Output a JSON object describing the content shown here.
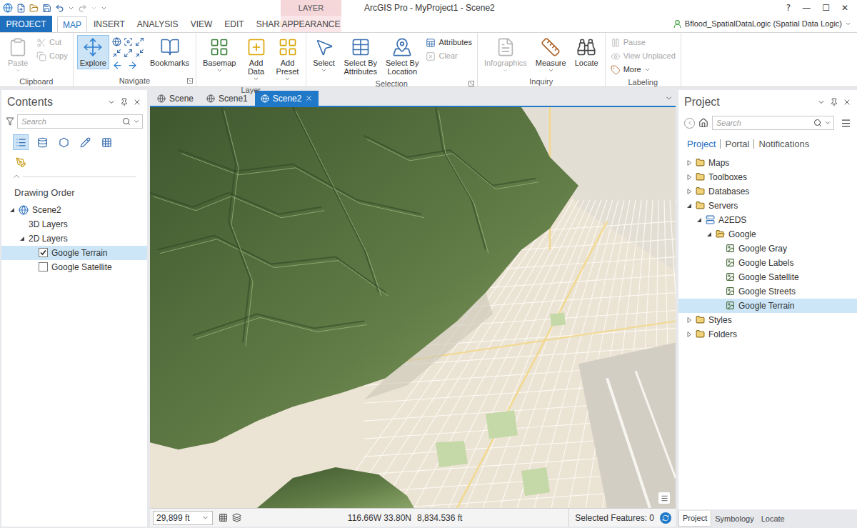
{
  "window": {
    "title": "ArcGIS Pro - MyProject1 - Scene2",
    "controls": [
      "?",
      "—",
      "☐",
      "✕"
    ]
  },
  "contextual_group": {
    "label": "LAYER"
  },
  "ribbon_tabs": [
    {
      "label": "PROJECT",
      "kind": "backstage",
      "selected": false
    },
    {
      "label": "MAP",
      "kind": "tab",
      "selected": true
    },
    {
      "label": "INSERT",
      "kind": "tab",
      "selected": false
    },
    {
      "label": "ANALYSIS",
      "kind": "tab",
      "selected": false
    },
    {
      "label": "VIEW",
      "kind": "tab",
      "selected": false
    },
    {
      "label": "EDIT",
      "kind": "tab",
      "selected": false
    },
    {
      "label": "SHARE",
      "kind": "tab",
      "selected": false
    },
    {
      "label": "APPEARANCE",
      "kind": "contextual",
      "selected": false
    }
  ],
  "user": {
    "label": "Bflood_SpatialDataLogic (Spatial Data Logic)"
  },
  "ribbon_groups": [
    {
      "label": "Clipboard",
      "launcher": false,
      "buttons": [
        {
          "kind": "large",
          "lines": [
            "Paste"
          ],
          "dropdown": true,
          "disabled": true,
          "selected": false
        },
        {
          "kind": "small",
          "lines": [
            "Cut"
          ],
          "dropdown": false,
          "disabled": true,
          "selected": false
        },
        {
          "kind": "small",
          "lines": [
            "Copy"
          ],
          "dropdown": false,
          "disabled": true,
          "selected": false
        }
      ]
    },
    {
      "label": "Navigate",
      "launcher": true,
      "buttons": [
        {
          "kind": "large",
          "lines": [
            "Explore"
          ],
          "dropdown": false,
          "disabled": false,
          "selected": true
        },
        {
          "kind": "nav-icons",
          "lines": [],
          "dropdown": false,
          "disabled": false,
          "selected": false
        },
        {
          "kind": "large",
          "lines": [
            "Bookmarks"
          ],
          "dropdown": false,
          "disabled": false,
          "selected": false
        }
      ]
    },
    {
      "label": "Layer",
      "launcher": false,
      "buttons": [
        {
          "kind": "large",
          "lines": [
            "Basemap"
          ],
          "dropdown": true,
          "disabled": false,
          "selected": false
        },
        {
          "kind": "large",
          "lines": [
            "Add",
            "Data"
          ],
          "dropdown": true,
          "disabled": false,
          "selected": false
        },
        {
          "kind": "large",
          "lines": [
            "Add",
            "Preset"
          ],
          "dropdown": true,
          "disabled": false,
          "selected": false
        }
      ]
    },
    {
      "label": "Selection",
      "launcher": true,
      "buttons": [
        {
          "kind": "large",
          "lines": [
            "Select"
          ],
          "dropdown": true,
          "disabled": false,
          "selected": false
        },
        {
          "kind": "large",
          "lines": [
            "Select By",
            "Attributes"
          ],
          "dropdown": false,
          "disabled": false,
          "selected": false
        },
        {
          "kind": "large",
          "lines": [
            "Select By",
            "Location"
          ],
          "dropdown": false,
          "disabled": false,
          "selected": false
        },
        {
          "kind": "small",
          "lines": [
            "Attributes"
          ],
          "dropdown": false,
          "disabled": false,
          "selected": false
        },
        {
          "kind": "small",
          "lines": [
            "Clear"
          ],
          "dropdown": false,
          "disabled": true,
          "selected": false
        }
      ]
    },
    {
      "label": "Inquiry",
      "launcher": false,
      "buttons": [
        {
          "kind": "large",
          "lines": [
            "Infographics"
          ],
          "dropdown": true,
          "disabled": true,
          "selected": false
        },
        {
          "kind": "large",
          "lines": [
            "Measure"
          ],
          "dropdown": true,
          "disabled": false,
          "selected": false
        },
        {
          "kind": "large",
          "lines": [
            "Locate"
          ],
          "dropdown": false,
          "disabled": false,
          "selected": false
        }
      ]
    },
    {
      "label": "Labeling",
      "launcher": false,
      "buttons": [
        {
          "kind": "small",
          "lines": [
            "Pause"
          ],
          "dropdown": false,
          "disabled": true,
          "selected": false
        },
        {
          "kind": "small",
          "lines": [
            "View Unplaced"
          ],
          "dropdown": false,
          "disabled": true,
          "selected": false
        },
        {
          "kind": "small",
          "lines": [
            "More"
          ],
          "dropdown": true,
          "disabled": false,
          "selected": false
        }
      ]
    }
  ],
  "contents": {
    "title": "Contents",
    "search": {
      "placeholder": "Search"
    },
    "views": [
      {
        "selected": true
      },
      {
        "selected": false
      },
      {
        "selected": false
      },
      {
        "selected": false
      },
      {
        "selected": false
      },
      {
        "selected": false
      }
    ],
    "heading": "Drawing Order",
    "tree": [
      {
        "label": "Scene2",
        "kind": "scene",
        "expandable": true,
        "expanded": true,
        "selected": false,
        "children": [
          {
            "label": "3D Layers",
            "kind": "group",
            "expandable": false,
            "expanded": false,
            "selected": false,
            "children": []
          },
          {
            "label": "2D Layers",
            "kind": "group",
            "expandable": true,
            "expanded": true,
            "selected": false,
            "children": [
              {
                "label": "Google Terrain",
                "kind": "layer",
                "expandable": false,
                "expanded": false,
                "selected": true,
                "checked": true,
                "children": []
              },
              {
                "label": "Google Satellite",
                "kind": "layer",
                "expandable": false,
                "expanded": false,
                "selected": false,
                "checked": false,
                "children": []
              }
            ]
          }
        ]
      }
    ]
  },
  "map_tabs": [
    {
      "label": "Scene",
      "selected": false
    },
    {
      "label": "Scene1",
      "selected": false
    },
    {
      "label": "Scene2",
      "selected": true
    }
  ],
  "map_status": {
    "scale": "29,899 ft",
    "coordinates": "116.66W 33.80N",
    "elevation": "8,834.536 ft",
    "selected_features": "Selected Features: 0"
  },
  "project": {
    "title": "Project",
    "search": {
      "placeholder": "Search"
    },
    "tabs": [
      {
        "label": "Project",
        "selected": true
      },
      {
        "label": "Portal",
        "selected": false
      },
      {
        "label": "Notifications",
        "selected": false
      }
    ],
    "tree": [
      {
        "label": "Maps",
        "kind": "folder",
        "expandable": true,
        "expanded": false,
        "selected": false,
        "children": []
      },
      {
        "label": "Toolboxes",
        "kind": "folder",
        "expandable": true,
        "expanded": false,
        "selected": false,
        "children": []
      },
      {
        "label": "Databases",
        "kind": "folder",
        "expandable": true,
        "expanded": false,
        "selected": false,
        "children": []
      },
      {
        "label": "Servers",
        "kind": "folder",
        "expandable": true,
        "expanded": true,
        "selected": false,
        "children": [
          {
            "label": "A2EDS",
            "kind": "server",
            "expandable": true,
            "expanded": true,
            "selected": false,
            "children": [
              {
                "label": "Google",
                "kind": "service-folder",
                "expandable": true,
                "expanded": true,
                "selected": false,
                "children": [
                  {
                    "label": "Google Gray",
                    "kind": "service",
                    "expandable": false,
                    "expanded": false,
                    "selected": false,
                    "children": []
                  },
                  {
                    "label": "Google Labels",
                    "kind": "service",
                    "expandable": false,
                    "expanded": false,
                    "selected": false,
                    "children": []
                  },
                  {
                    "label": "Google Satellite",
                    "kind": "service",
                    "expandable": false,
                    "expanded": false,
                    "selected": false,
                    "children": []
                  },
                  {
                    "label": "Google Streets",
                    "kind": "service",
                    "expandable": false,
                    "expanded": false,
                    "selected": false,
                    "children": []
                  },
                  {
                    "label": "Google Terrain",
                    "kind": "service",
                    "expandable": false,
                    "expanded": false,
                    "selected": true,
                    "children": []
                  }
                ]
              }
            ]
          }
        ]
      },
      {
        "label": "Styles",
        "kind": "folder",
        "expandable": true,
        "expanded": false,
        "selected": false,
        "children": []
      },
      {
        "label": "Folders",
        "kind": "folder",
        "expandable": true,
        "expanded": false,
        "selected": false,
        "children": []
      }
    ],
    "bottom_tabs": [
      {
        "label": "Project",
        "selected": true
      },
      {
        "label": "Symbology",
        "selected": false
      },
      {
        "label": "Locate",
        "selected": false
      }
    ]
  }
}
